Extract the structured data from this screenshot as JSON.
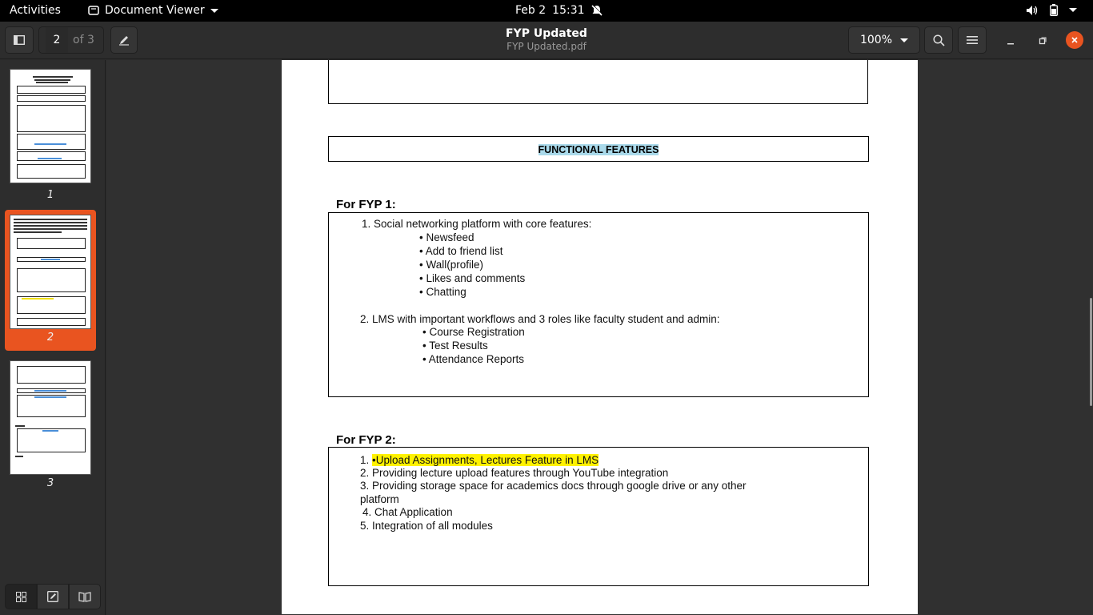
{
  "topbar": {
    "activities": "Activities",
    "app_name": "Document Viewer",
    "date": "Feb 2",
    "time": "15:31"
  },
  "header": {
    "page_current": "2",
    "page_total": "of 3",
    "title": "FYP Updated",
    "subtitle": "FYP Updated.pdf",
    "zoom": "100%"
  },
  "sidebar": {
    "thumbnails": [
      {
        "label": "1"
      },
      {
        "label": "2"
      },
      {
        "label": "3"
      }
    ],
    "selected_page": 2
  },
  "document": {
    "section_title": "FUNCTIONAL FEATURES",
    "fyp1": {
      "heading": "For FYP 1:",
      "item1": "1. Social networking platform with core features:",
      "item1_bullets": [
        "• Newsfeed",
        "• Add to friend list",
        "• Wall(profile)",
        "• Likes and comments",
        "• Chatting"
      ],
      "item2": "2. LMS with important workflows and 3 roles like faculty student and admin:",
      "item2_bullets": [
        "• Course Registration",
        "• Test Results",
        "• Attendance Reports"
      ]
    },
    "fyp2": {
      "heading": "For FYP 2:",
      "item1_num": "1.",
      "item1_text": "•Upload Assignments, Lectures Feature in LMS",
      "item2": "2. Providing lecture upload features through YouTube integration",
      "item3a": "3. Providing storage space for academics docs through google drive or any other",
      "item3b": "platform",
      "item4": "4. Chat Application",
      "item5": "5. Integration of all modules"
    }
  },
  "colors": {
    "accent": "#e95420",
    "highlight_yellow": "#fff200",
    "highlight_blue": "#a9d9ea"
  }
}
